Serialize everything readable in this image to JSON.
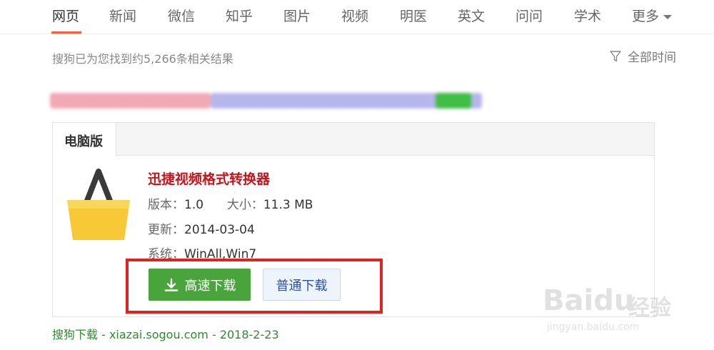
{
  "nav": {
    "items": [
      "网页",
      "新闻",
      "微信",
      "知乎",
      "图片",
      "视频",
      "明医",
      "英文",
      "问问",
      "学术",
      "更多"
    ],
    "active": "网页"
  },
  "results": {
    "count_text": "搜狗已为您找到约5,266条相关结果",
    "time_filter": "全部时间"
  },
  "card": {
    "tab_label": "电脑版",
    "app_name": "迅捷视频格式转换器",
    "version_label": "版本：",
    "version": "1.0",
    "size_label": "大小：",
    "size": "11.3 MB",
    "updated_label": "更新：",
    "updated": "2014-03-04",
    "system_label": "系统：",
    "system": "WinAll,Win7",
    "fast_download": "高速下载",
    "normal_download": "普通下载"
  },
  "source": "搜狗下载 - xiazai.sogou.com - 2018-2-23",
  "watermark": {
    "brand": "Baidu",
    "brand_suffix": "经验",
    "url": "jingyan.baidu.com"
  },
  "colors": {
    "accent": "#f4613c",
    "app_title": "#c0161c",
    "download_green": "#4aa43c",
    "link_green": "#2f8a2f",
    "highlight_red": "#e02320"
  },
  "icons": {
    "filter": "funnel-icon",
    "download": "download-arrow-icon",
    "app": "basket-icon",
    "more": "chevron-down-icon"
  }
}
